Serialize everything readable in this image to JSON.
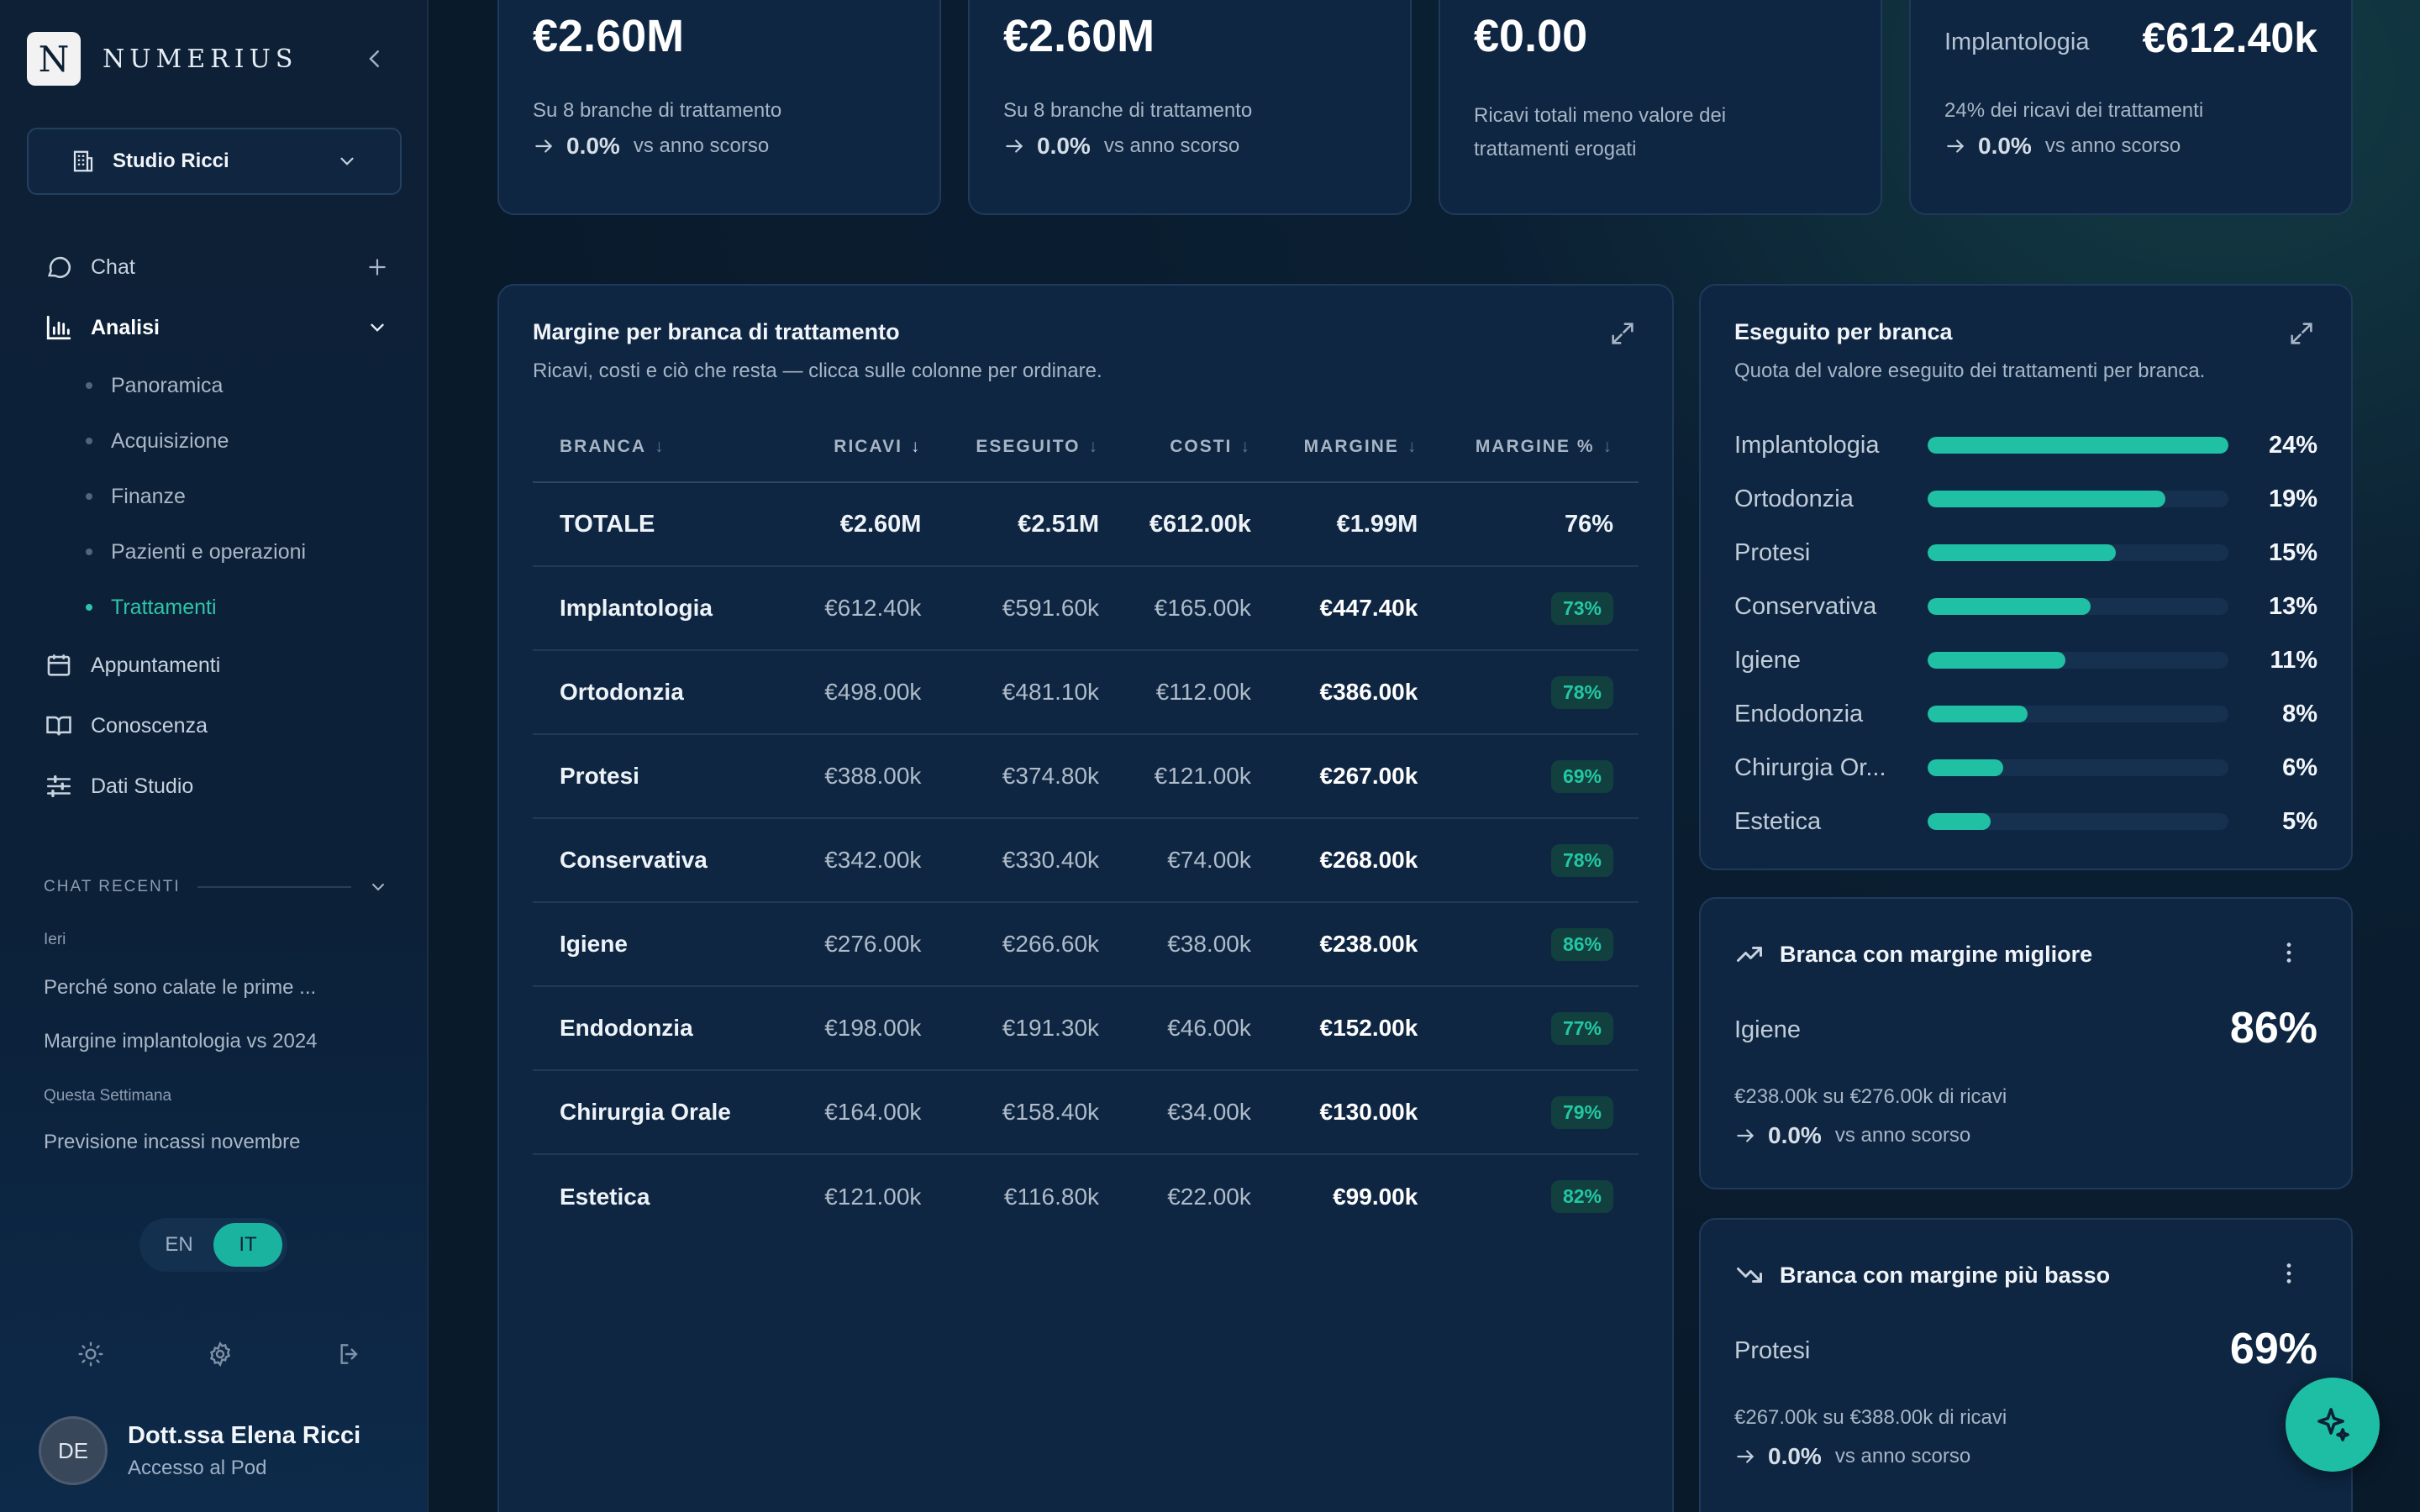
{
  "brand": {
    "name": "NUMERIUS",
    "logo_letter": "N"
  },
  "studio": {
    "selected": "Studio Ricci"
  },
  "nav": {
    "chat": "Chat",
    "analisi": "Analisi",
    "sub": [
      "Panoramica",
      "Acquisizione",
      "Finanze",
      "Pazienti e operazioni",
      "Trattamenti"
    ],
    "appuntamenti": "Appuntamenti",
    "conoscenza": "Conoscenza",
    "dati_studio": "Dati Studio"
  },
  "recent": {
    "header": "CHAT RECENTI",
    "groups": [
      {
        "label": "Ieri",
        "items": [
          "Perché sono calate le prime ...",
          "Margine implantologia vs 2024"
        ]
      },
      {
        "label": "Questa Settimana",
        "items": [
          "Previsione incassi novembre"
        ]
      }
    ]
  },
  "lang": {
    "en": "EN",
    "it": "IT",
    "active": "IT"
  },
  "user": {
    "initials": "DE",
    "name": "Dott.ssa Elena Ricci",
    "role": "Accesso al Pod"
  },
  "kpis": [
    {
      "value": "€2.60M",
      "desc": "Su 8 branche di trattamento",
      "trend": "0.0%",
      "trend_label": "vs anno scorso"
    },
    {
      "value": "€2.60M",
      "desc": "Su 8 branche di trattamento",
      "trend": "0.0%",
      "trend_label": "vs anno scorso"
    },
    {
      "value": "€0.00",
      "desc": "Ricavi totali meno valore dei trattamenti erogati"
    },
    {
      "label": "Implantologia",
      "value": "€612.40k",
      "desc": "24% dei ricavi dei trattamenti",
      "trend": "0.0%",
      "trend_label": "vs anno scorso"
    }
  ],
  "margin_table": {
    "title": "Margine per branca di trattamento",
    "subtitle": "Ricavi, costi e ciò che resta — clicca sulle colonne per ordinare.",
    "columns": [
      "BRANCA",
      "RICAVI",
      "ESEGUITO",
      "COSTI",
      "MARGINE",
      "MARGINE %"
    ],
    "total": {
      "branca": "TOTALE",
      "ricavi": "€2.60M",
      "eseguito": "€2.51M",
      "costi": "€612.00k",
      "margine": "€1.99M",
      "margine_pct": "76%"
    },
    "rows": [
      {
        "branca": "Implantologia",
        "ricavi": "€612.40k",
        "eseguito": "€591.60k",
        "costi": "€165.00k",
        "margine": "€447.40k",
        "margine_pct": "73%"
      },
      {
        "branca": "Ortodonzia",
        "ricavi": "€498.00k",
        "eseguito": "€481.10k",
        "costi": "€112.00k",
        "margine": "€386.00k",
        "margine_pct": "78%"
      },
      {
        "branca": "Protesi",
        "ricavi": "€388.00k",
        "eseguito": "€374.80k",
        "costi": "€121.00k",
        "margine": "€267.00k",
        "margine_pct": "69%"
      },
      {
        "branca": "Conservativa",
        "ricavi": "€342.00k",
        "eseguito": "€330.40k",
        "costi": "€74.00k",
        "margine": "€268.00k",
        "margine_pct": "78%"
      },
      {
        "branca": "Igiene",
        "ricavi": "€276.00k",
        "eseguito": "€266.60k",
        "costi": "€38.00k",
        "margine": "€238.00k",
        "margine_pct": "86%"
      },
      {
        "branca": "Endodonzia",
        "ricavi": "€198.00k",
        "eseguito": "€191.30k",
        "costi": "€46.00k",
        "margine": "€152.00k",
        "margine_pct": "77%"
      },
      {
        "branca": "Chirurgia Orale",
        "ricavi": "€164.00k",
        "eseguito": "€158.40k",
        "costi": "€34.00k",
        "margine": "€130.00k",
        "margine_pct": "79%"
      },
      {
        "branca": "Estetica",
        "ricavi": "€121.00k",
        "eseguito": "€116.80k",
        "costi": "€22.00k",
        "margine": "€99.00k",
        "margine_pct": "82%"
      }
    ]
  },
  "executed": {
    "title": "Eseguito per branca",
    "subtitle": "Quota del valore eseguito dei trattamenti per branca.",
    "accent": "#1fc0a4",
    "items": [
      {
        "label": "Implantologia",
        "pct": "24%",
        "value": 24
      },
      {
        "label": "Ortodonzia",
        "pct": "19%",
        "value": 19
      },
      {
        "label": "Protesi",
        "pct": "15%",
        "value": 15
      },
      {
        "label": "Conservativa",
        "pct": "13%",
        "value": 13
      },
      {
        "label": "Igiene",
        "pct": "11%",
        "value": 11
      },
      {
        "label": "Endodonzia",
        "pct": "8%",
        "value": 8
      },
      {
        "label": "Chirurgia Or...",
        "pct": "6%",
        "value": 6
      },
      {
        "label": "Estetica",
        "pct": "5%",
        "value": 5
      }
    ]
  },
  "best": {
    "title": "Branca con margine migliore",
    "branch": "Igiene",
    "pct": "86%",
    "desc": "€238.00k su €276.00k di ricavi",
    "trend": "0.0%",
    "trend_label": "vs anno scorso"
  },
  "worst": {
    "title": "Branca con margine più basso",
    "branch": "Protesi",
    "pct": "69%",
    "desc": "€267.00k su €388.00k di ricavi",
    "trend": "0.0%",
    "trend_label": "vs anno scorso"
  }
}
